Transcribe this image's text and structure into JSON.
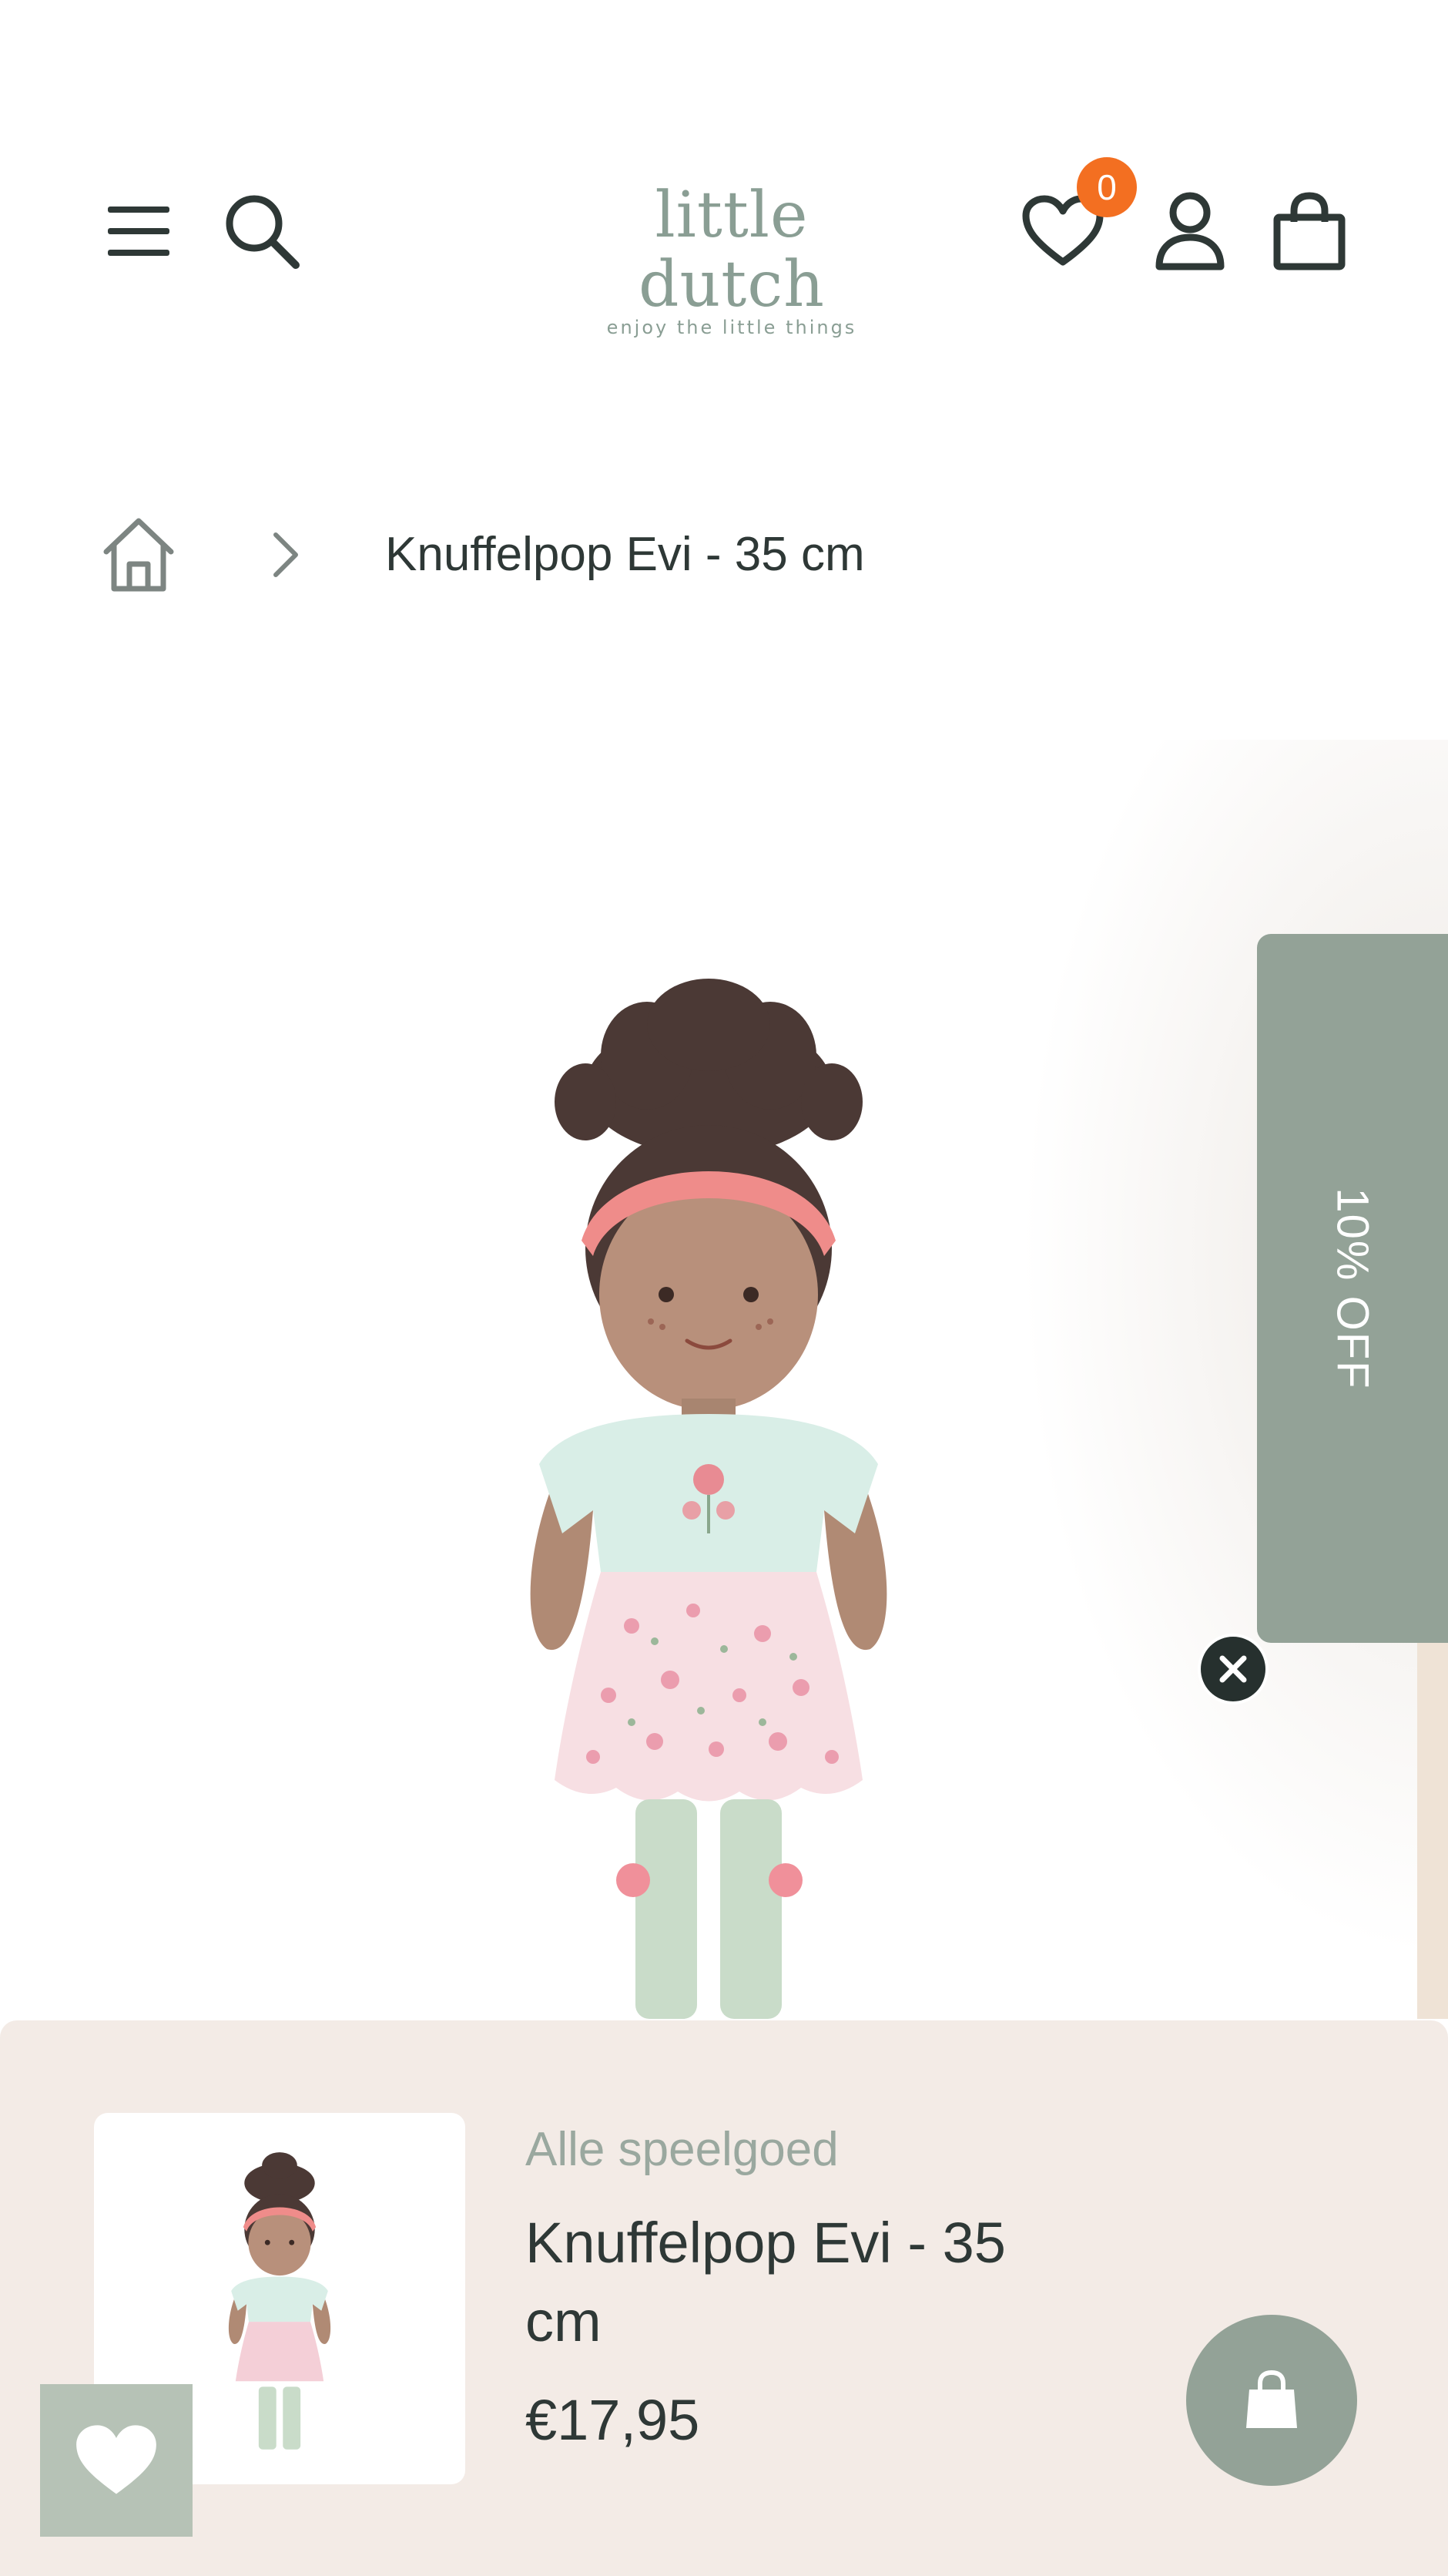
{
  "header": {
    "menu_icon": "hamburger-icon",
    "search_icon": "search-icon",
    "logo": {
      "name": "little dutch",
      "tagline": "enjoy the little things"
    },
    "wishlist": {
      "icon": "heart-icon",
      "count": "0"
    },
    "account_icon": "user-icon",
    "cart_icon": "shopping-bag-icon"
  },
  "breadcrumb": {
    "home_icon": "home-icon",
    "separator_icon": "chevron-right-icon",
    "current": "Knuffelpop Evi - 35 cm"
  },
  "promo_tab": {
    "label": "10% OFF",
    "close_icon": "close-icon"
  },
  "sticky_bar": {
    "category": "Alle speelgoed",
    "product_name": "Knuffelpop Evi - 35 cm",
    "price": "€17,95",
    "cart_button_icon": "shopping-bag-icon"
  },
  "floating_wishlist": {
    "icon": "heart-icon"
  },
  "colors": {
    "accent_sage": "#93a297",
    "badge_orange": "#f36f21",
    "sticky_bg": "#f3ebe6",
    "text_dark": "#2e3836"
  }
}
